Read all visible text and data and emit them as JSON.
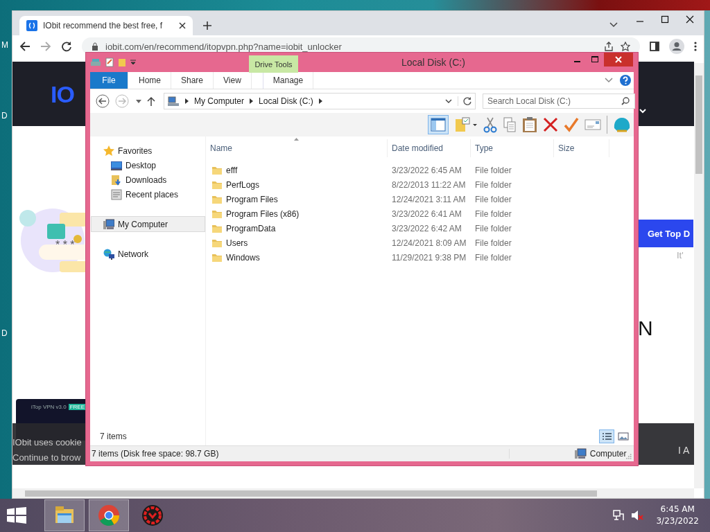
{
  "desktop": {
    "icon_labels": [
      "M",
      "D",
      "D"
    ]
  },
  "browser": {
    "tabs": [
      {
        "title": "IObit recommend the best free, f",
        "selected": true
      }
    ],
    "address": "iobit.com/en/recommend/itopvpn.php?name=iobit_unlocker",
    "page": {
      "logo": "IO",
      "password_mask": "* * *",
      "cta_button": "Get Top D",
      "cta_note": "It'",
      "heading_fragment": "N",
      "promo": {
        "title": "iTop VPN v3.0",
        "badge": "FREE"
      },
      "cookie_lines": [
        "IObit uses cookie",
        "Continue to brow"
      ],
      "cookie_fragment": "I A"
    }
  },
  "explorer": {
    "title": "Local Disk (C:)",
    "context_tab": "Drive Tools",
    "ribbon_tabs": [
      {
        "label": "File",
        "kind": "file"
      },
      {
        "label": "Home",
        "kind": "plain"
      },
      {
        "label": "Share",
        "kind": "plain"
      },
      {
        "label": "View",
        "kind": "plain"
      },
      {
        "label": "Manage",
        "kind": "context"
      }
    ],
    "breadcrumb": [
      "My Computer",
      "Local Disk (C:)"
    ],
    "search": {
      "placeholder": "Search Local Disk (C:)"
    },
    "nav": [
      {
        "label": "Favorites",
        "kind": "star",
        "selected": false,
        "children": [
          {
            "label": "Desktop",
            "kind": "desktop",
            "selected": false
          },
          {
            "label": "Downloads",
            "kind": "downloads",
            "selected": false
          },
          {
            "label": "Recent places",
            "kind": "recent",
            "selected": false
          }
        ]
      },
      {
        "label": "My Computer",
        "kind": "computer",
        "selected": true
      },
      {
        "label": "Network",
        "kind": "network",
        "selected": false
      }
    ],
    "columns": [
      "Name",
      "Date modified",
      "Type",
      "Size"
    ],
    "rows": [
      {
        "name": "efff",
        "date": "3/23/2022 6:45 AM",
        "type": "File folder"
      },
      {
        "name": "PerfLogs",
        "date": "8/22/2013 11:22 AM",
        "type": "File folder"
      },
      {
        "name": "Program Files",
        "date": "12/24/2021 3:11 AM",
        "type": "File folder"
      },
      {
        "name": "Program Files (x86)",
        "date": "3/23/2022 6:41 AM",
        "type": "File folder"
      },
      {
        "name": "ProgramData",
        "date": "3/23/2022 6:42 AM",
        "type": "File folder"
      },
      {
        "name": "Users",
        "date": "12/24/2021 8:09 AM",
        "type": "File folder"
      },
      {
        "name": "Windows",
        "date": "11/29/2021 9:38 PM",
        "type": "File folder"
      }
    ],
    "item_count": "7 items",
    "status": "7 items (Disk free space: 98.7 GB)",
    "status_location": "Computer"
  },
  "taskbar": {
    "apps": [
      {
        "kind": "explorer",
        "selected": true
      },
      {
        "kind": "chrome",
        "selected": true
      },
      {
        "kind": "iobit",
        "selected": false
      }
    ],
    "time": "6:45 AM",
    "date": "3/23/2022"
  }
}
